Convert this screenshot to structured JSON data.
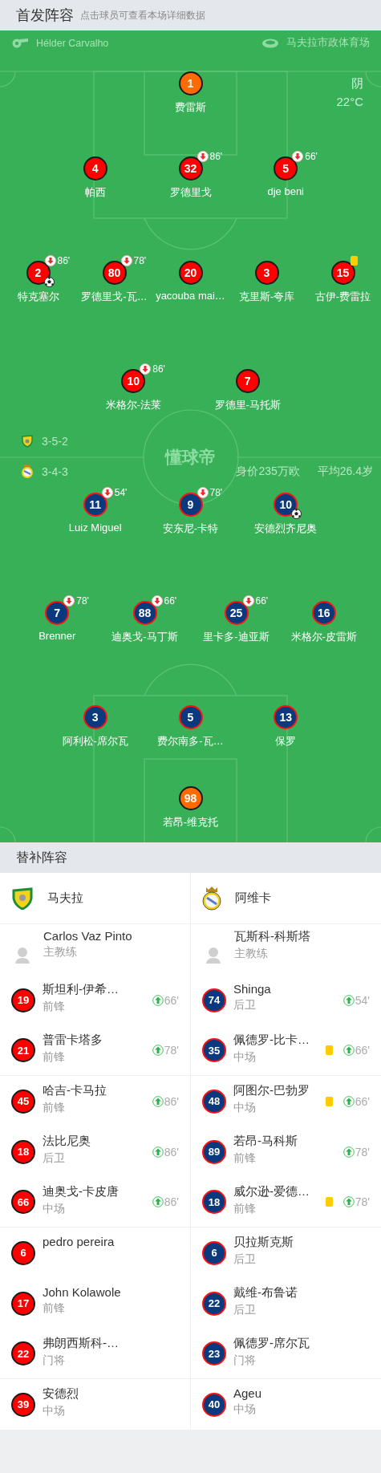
{
  "header": {
    "title": "首发阵容",
    "hint": "点击球员可查看本场详细数据"
  },
  "match": {
    "referee": "Hélder Carvalho",
    "venue": "马夫拉市政体育场",
    "weather": "阴",
    "temperature": "22°C",
    "logo": "懂球帝"
  },
  "home": {
    "formation": "3-5-2",
    "lines": [
      [
        {
          "number": "1",
          "name": "费雷斯",
          "kind": "goalkeeper"
        }
      ],
      [
        {
          "number": "4",
          "name": "帕西",
          "kind": "outfield"
        },
        {
          "number": "32",
          "name": "罗德里戈",
          "kind": "outfield",
          "subbed_off": "86'"
        },
        {
          "number": "5",
          "name": "dje beni",
          "kind": "outfield",
          "subbed_off": "66'"
        }
      ],
      [
        {
          "number": "2",
          "name": "特克塞尔",
          "kind": "outfield",
          "subbed_off": "86'",
          "goal": true
        },
        {
          "number": "80",
          "name": "罗德里戈-瓦…",
          "kind": "outfield",
          "subbed_off": "78'"
        },
        {
          "number": "20",
          "name": "yacouba mai…",
          "kind": "outfield"
        },
        {
          "number": "3",
          "name": "克里斯-夸库",
          "kind": "outfield"
        },
        {
          "number": "15",
          "name": "古伊-费雷拉",
          "kind": "outfield",
          "yellow_card": true
        }
      ],
      [
        {
          "number": "10",
          "name": "米格尔-法莱",
          "kind": "outfield",
          "subbed_off": "86'"
        },
        {
          "number": "7",
          "name": "罗德里-马托斯",
          "kind": "outfield"
        }
      ]
    ]
  },
  "away": {
    "formation": "3-4-3",
    "market_value": "身价235万欧",
    "average_age": "平均26.4岁",
    "lines": [
      [
        {
          "number": "11",
          "name": "Luiz Miguel",
          "kind": "outfield",
          "subbed_off": "54'"
        },
        {
          "number": "9",
          "name": "安东尼-卡特",
          "kind": "outfield",
          "subbed_off": "78'"
        },
        {
          "number": "10",
          "name": "安德烈齐尼奥",
          "kind": "outfield",
          "goal": true
        }
      ],
      [
        {
          "number": "7",
          "name": "Brenner",
          "kind": "outfield",
          "subbed_off": "78'"
        },
        {
          "number": "88",
          "name": "迪奥戈-马丁斯",
          "kind": "outfield",
          "subbed_off": "66'"
        },
        {
          "number": "25",
          "name": "里卡多-迪亚斯",
          "kind": "outfield",
          "subbed_off": "66'"
        },
        {
          "number": "16",
          "name": "米格尔-皮雷斯",
          "kind": "outfield"
        }
      ],
      [
        {
          "number": "3",
          "name": "阿利松-席尔瓦",
          "kind": "outfield"
        },
        {
          "number": "5",
          "name": "费尔南多-瓦…",
          "kind": "outfield"
        },
        {
          "number": "13",
          "name": "保罗",
          "kind": "outfield"
        }
      ],
      [
        {
          "number": "98",
          "name": "若昂-维克托",
          "kind": "goalkeeper"
        }
      ]
    ]
  },
  "bench": {
    "title": "替补阵容",
    "teams": [
      {
        "name": "马夫拉",
        "coach": {
          "name": "Carlos Vaz Pinto",
          "role": "主教练"
        },
        "players": [
          {
            "number": "19",
            "name": "斯坦利-伊希…",
            "position": "前锋",
            "subbed_on": "66'"
          },
          {
            "number": "21",
            "name": "普雷卡塔多",
            "position": "前锋",
            "subbed_on": "78'"
          },
          {
            "number": "45",
            "name": "哈吉-卡马拉",
            "position": "前锋",
            "subbed_on": "86'"
          },
          {
            "number": "18",
            "name": "法比尼奥",
            "position": "后卫",
            "subbed_on": "86'"
          },
          {
            "number": "66",
            "name": "迪奥戈-卡皮唐",
            "position": "中场",
            "subbed_on": "86'"
          },
          {
            "number": "6",
            "name": "pedro pereira"
          },
          {
            "number": "17",
            "name": "John Kolawole",
            "position": "前锋"
          },
          {
            "number": "22",
            "name": "弗朗西斯科-…",
            "position": "门将"
          },
          {
            "number": "39",
            "name": "安德烈",
            "position": "中场"
          }
        ]
      },
      {
        "name": "阿维卡",
        "coach": {
          "name": "瓦斯科-科斯塔",
          "role": "主教练"
        },
        "players": [
          {
            "number": "74",
            "name": "Shinga",
            "position": "后卫",
            "subbed_on": "54'"
          },
          {
            "number": "35",
            "name": "佩德罗-比卡…",
            "position": "中场",
            "subbed_on": "66'",
            "yellow_card": true
          },
          {
            "number": "48",
            "name": "阿图尔-巴勃罗",
            "position": "中场",
            "subbed_on": "66'",
            "yellow_card": true
          },
          {
            "number": "89",
            "name": "若昂-马科斯",
            "position": "前锋",
            "subbed_on": "78'"
          },
          {
            "number": "18",
            "name": "威尔逊-爱德…",
            "position": "前锋",
            "subbed_on": "78'",
            "yellow_card": true
          },
          {
            "number": "6",
            "name": "贝拉斯克斯",
            "position": "后卫"
          },
          {
            "number": "22",
            "name": "戴维-布鲁诺",
            "position": "后卫"
          },
          {
            "number": "23",
            "name": "佩德罗-席尔瓦",
            "position": "门将"
          },
          {
            "number": "40",
            "name": "Ageu",
            "position": "中场"
          }
        ]
      }
    ]
  }
}
